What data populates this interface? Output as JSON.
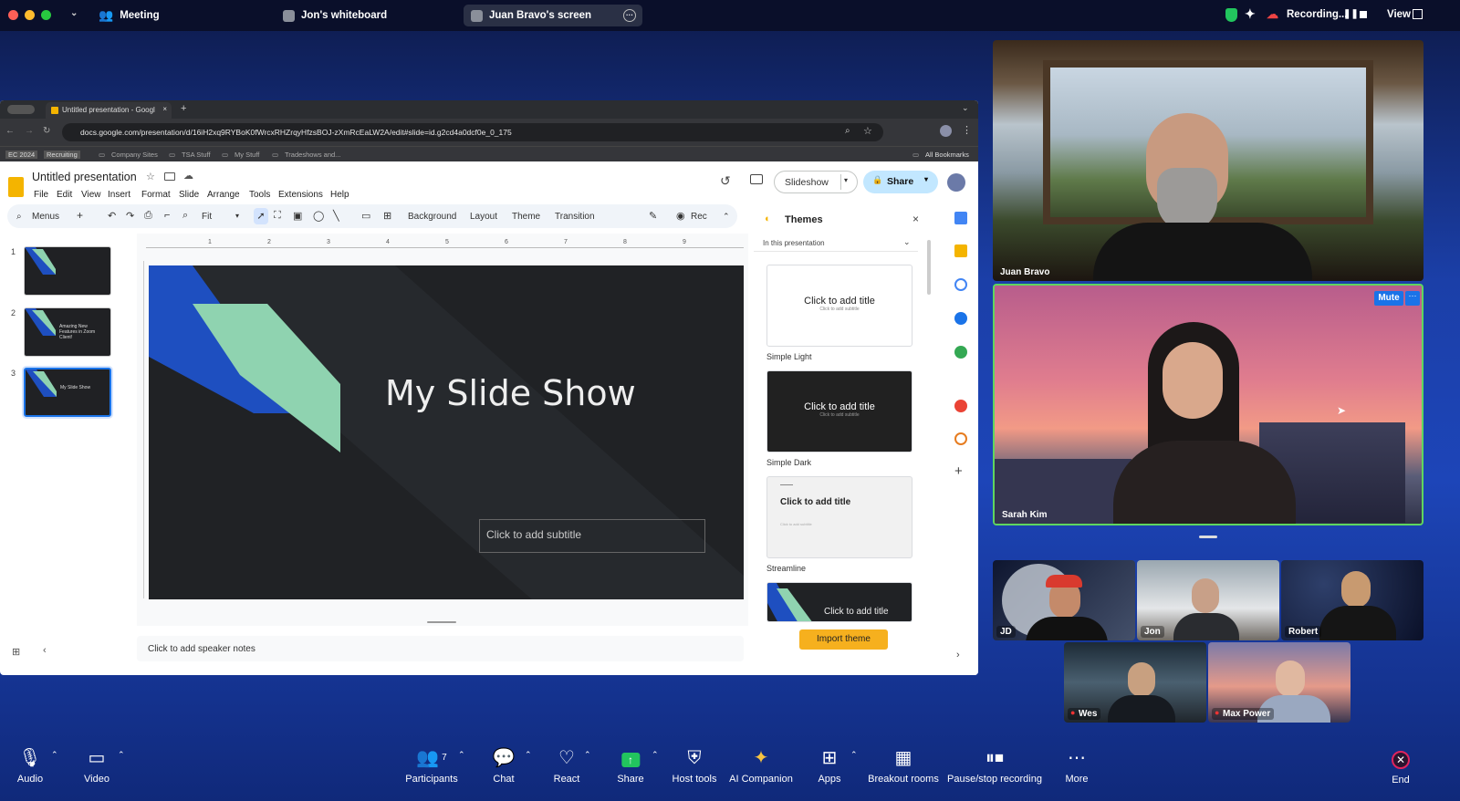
{
  "topbar": {
    "meeting_label": "Meeting",
    "tabs": [
      {
        "label": "Jon's whiteboard"
      },
      {
        "label": "Juan Bravo's screen"
      }
    ],
    "recording_label": "Recording...",
    "view_label": "View"
  },
  "browser": {
    "tab_title": "Untitled presentation - Googl",
    "url": "docs.google.com/presentation/d/16iH2xq9RYBoK0fWrcxRHZrqyHfzsBOJ-zXmRcEaLW2A/edit#slide=id.g2cd4a0dcf0e_0_175",
    "bookmarks": [
      "EC 2024",
      "Recruiting",
      "Company Sites",
      "TSA Stuff",
      "My Stuff",
      "Tradeshows and...",
      "All Bookmarks"
    ]
  },
  "slides_app": {
    "doc_title": "Untitled presentation",
    "menu": [
      "File",
      "Edit",
      "View",
      "Insert",
      "Format",
      "Slide",
      "Arrange",
      "Tools",
      "Extensions",
      "Help"
    ],
    "slideshow_label": "Slideshow",
    "share_label": "Share",
    "toolbar": {
      "menus_label": "Menus",
      "zoom_label": "Fit",
      "background_label": "Background",
      "layout_label": "Layout",
      "theme_label": "Theme",
      "transition_label": "Transition",
      "rec_label": "Rec"
    },
    "ruler_numbers": [
      "1",
      "2",
      "3",
      "4",
      "5",
      "6",
      "7",
      "8",
      "9"
    ],
    "thumbnails": [
      {
        "num": "1",
        "text": ""
      },
      {
        "num": "2",
        "text": "Amazing New Features in Zoom Client!"
      },
      {
        "num": "3",
        "text": "My Slide Show"
      }
    ],
    "slide": {
      "title": "My Slide Show",
      "subtitle_placeholder": "Click to add subtitle"
    },
    "speaker_notes": "Click to add speaker notes",
    "themes_panel": {
      "title": "Themes",
      "dropdown": "In this presentation",
      "themes": [
        {
          "name": "Simple Light",
          "preview": "Click to add title",
          "sub": "Click to add subtitle"
        },
        {
          "name": "Simple Dark",
          "preview": "Click to add title",
          "sub": "Click to add subtitle"
        },
        {
          "name": "Streamline",
          "preview": "Click to add title",
          "sub": "Click to add subtitle"
        },
        {
          "name": "",
          "preview": "Click to add title",
          "sub": ""
        }
      ],
      "import_label": "Import theme"
    }
  },
  "participants_video": {
    "speaker_top": "Juan Bravo",
    "speaker_active": "Sarah Kim",
    "mute_label": "Mute",
    "gallery": [
      "JD",
      "Jon",
      "Robert",
      "Wes",
      "Max Power"
    ]
  },
  "dock": {
    "audio": "Audio",
    "video": "Video",
    "participants": "Participants",
    "participants_count": "7",
    "chat": "Chat",
    "react": "React",
    "share": "Share",
    "host_tools": "Host tools",
    "ai_companion": "AI Companion",
    "apps": "Apps",
    "breakout": "Breakout rooms",
    "pause_recording": "Pause/stop recording",
    "more": "More",
    "end": "End"
  },
  "colors": {
    "zoom_blue": "#1d45b8",
    "share_green": "#22c55e",
    "import_yellow": "#f6b01e",
    "active_speaker_border": "#5fd65f",
    "slide_blue": "#1e4fc0",
    "slide_green": "#8fd3b0"
  }
}
